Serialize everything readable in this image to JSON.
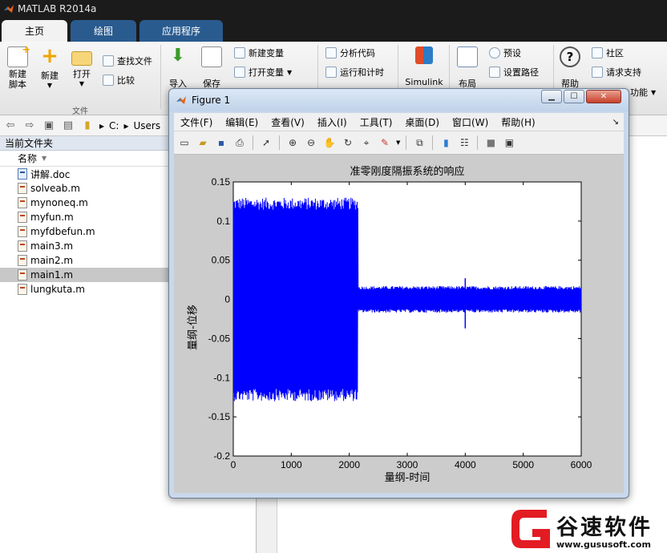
{
  "app": {
    "title": "MATLAB R2014a"
  },
  "tabs": [
    {
      "label": "主页"
    },
    {
      "label": "绘图"
    },
    {
      "label": "应用程序"
    }
  ],
  "ribbon": {
    "new_script": "新建\n脚本",
    "new": "新建",
    "open": "打开",
    "find_files": "查找文件",
    "compare": "比较",
    "file_group": "文件",
    "import": "导入",
    "save": "保存",
    "new_variable": "新建变量",
    "open_variable": "打开变量",
    "analyze_code": "分析代码",
    "run_and_time": "运行和计时",
    "simulink": "Simulink",
    "layout": "布局",
    "preferences": "预设",
    "set_path": "设置路径",
    "help": "帮助",
    "community": "社区",
    "request_support": "请求支持",
    "addons_partial": "功能"
  },
  "address": {
    "drive": "C:",
    "folder": "Users"
  },
  "filepanel": {
    "title": "当前文件夹",
    "col_name": "名称",
    "files": [
      {
        "name": "讲解.doc",
        "type": "doc"
      },
      {
        "name": "solveab.m",
        "type": "m"
      },
      {
        "name": "mynoneq.m",
        "type": "m"
      },
      {
        "name": "myfun.m",
        "type": "m"
      },
      {
        "name": "myfdbefun.m",
        "type": "m"
      },
      {
        "name": "main3.m",
        "type": "m"
      },
      {
        "name": "main2.m",
        "type": "m"
      },
      {
        "name": "main1.m",
        "type": "m",
        "selected": true
      },
      {
        "name": "lungkuta.m",
        "type": "m"
      }
    ]
  },
  "figure": {
    "title": "Figure 1",
    "menu": [
      "文件(F)",
      "编辑(E)",
      "查看(V)",
      "插入(I)",
      "工具(T)",
      "桌面(D)",
      "窗口(W)",
      "帮助(H)"
    ],
    "toolbar_icons": [
      "new-figure-icon",
      "open-icon",
      "save-icon",
      "print-icon",
      "pointer-icon",
      "zoom-in-icon",
      "zoom-out-icon",
      "pan-icon",
      "rotate-icon",
      "data-cursor-icon",
      "brush-icon",
      "link-icon",
      "colorbar-icon",
      "legend-icon",
      "hide-tools-icon",
      "show-tools-icon"
    ]
  },
  "chart_data": {
    "type": "line",
    "title": "准零刚度隔振系统的响应",
    "xlabel": "量纲-时间",
    "ylabel": "量纲-位移",
    "xlim": [
      0,
      6000
    ],
    "ylim": [
      -0.2,
      0.15
    ],
    "xticks": [
      "0",
      "1000",
      "2000",
      "3000",
      "4000",
      "5000",
      "6000"
    ],
    "yticks": [
      "0.15",
      "0.1",
      "0.05",
      "0",
      "-0.05",
      "-0.1",
      "-0.15",
      "-0.2"
    ],
    "line_color": "#0000ff",
    "grid": false,
    "series": [
      {
        "segments": [
          {
            "x_start": 0,
            "x_end": 2150,
            "amplitude": 0.13
          },
          {
            "x_start": 2150,
            "x_end": 6000,
            "amplitude": 0.017,
            "center": 0.0
          },
          {
            "x": 4000,
            "spike_min": -0.037,
            "spike_max": 0.027
          }
        ]
      }
    ]
  },
  "watermark": {
    "text": "谷速软件",
    "url": "www.gususoft.com",
    "brand_color": "#e31b23"
  }
}
